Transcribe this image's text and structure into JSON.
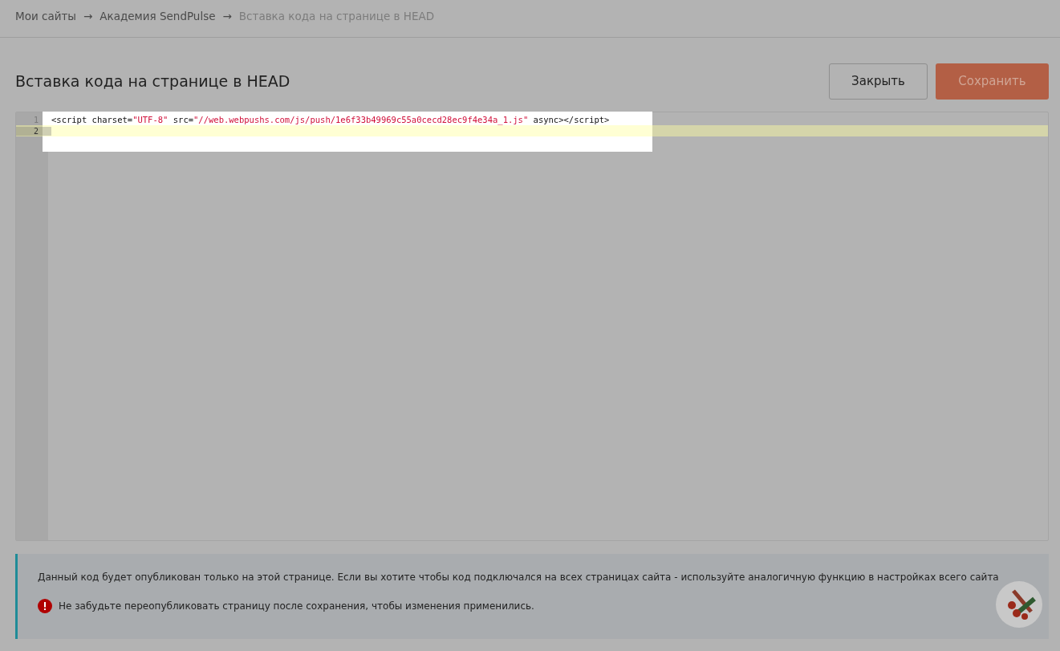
{
  "breadcrumbs": [
    {
      "label": "Мои сайты",
      "current": false
    },
    {
      "label": "Академия SendPulse",
      "current": false
    },
    {
      "label": "Вставка кода на странице в HEAD",
      "current": true
    }
  ],
  "breadcrumb_separator": "→",
  "title": "Вставка кода на странице в HEAD",
  "buttons": [
    {
      "label": "Закрыть",
      "kind": "secondary"
    },
    {
      "label": "Сохранить",
      "kind": "primary"
    }
  ],
  "editor": {
    "lines": [
      {
        "number": "1",
        "active": false,
        "tokens": [
          {
            "text": "<script ",
            "kind": "tag"
          },
          {
            "text": "charset=",
            "kind": "attr"
          },
          {
            "text": "\"UTF-8\"",
            "kind": "string"
          },
          {
            "text": " src=",
            "kind": "attr"
          },
          {
            "text": "\"//web.webpushs.com/js/push/1e6f33b49969c55a0cecd28ec9f4e34a_1.js\"",
            "kind": "string"
          },
          {
            "text": " async",
            "kind": "attr"
          },
          {
            "text": "></script>",
            "kind": "tag"
          }
        ]
      },
      {
        "number": "2",
        "active": true
      }
    ]
  },
  "notice": {
    "text": "Данный код будет опубликован только на этой странице. Если вы хотите чтобы код подключался на всех страницах сайта - используйте аналогичную функцию в настройках всего сайта",
    "warning": "Не забудьте переопубликовать страницу после сохранения, чтобы изменения применились."
  }
}
